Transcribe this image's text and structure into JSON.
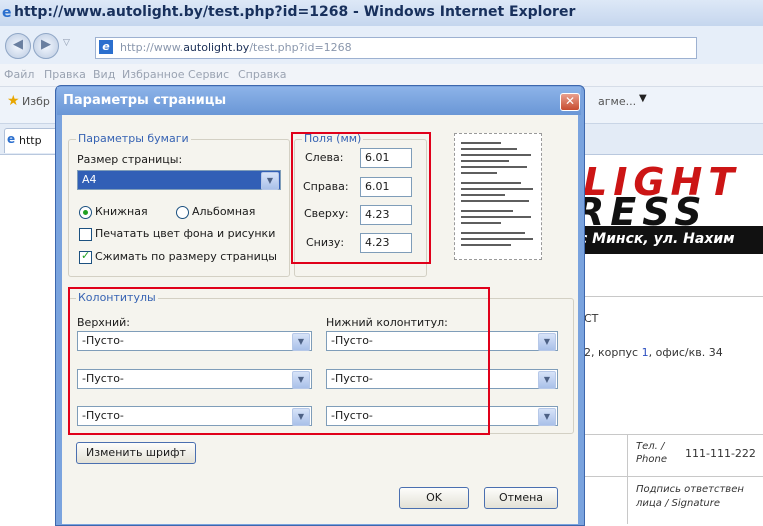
{
  "window": {
    "title": "http://www.autolight.by/test.php?id=1268 - Windows Internet Explorer",
    "address_prefix": "http://www.",
    "address_domain": "autolight.by",
    "address_path": "/test.php?id=1268",
    "menu": [
      "Файл",
      "Правка",
      "Вид",
      "Избранное",
      "Сервис",
      "Справка"
    ],
    "fav_label": "Избр",
    "tab_label": "http",
    "toolbar_suffix": "агме..."
  },
  "background_page": {
    "logo_line1": "LIGHT",
    "logo_line2": "RESS",
    "address_band": "с Минск, ул. Нахим",
    "text1": "СТ",
    "text2_pre": "2, корпус ",
    "text2_num": "1",
    "text2_post": ", офис/кв. 34",
    "phone_label1": "Тел. /",
    "phone_label2": "Phone",
    "phone_value": "111-111-222",
    "sign_label1": "Подпись ответствен",
    "sign_label2": "лица / Signature"
  },
  "dialog": {
    "title": "Параметры страницы",
    "paper": {
      "group_label": "Параметры бумаги",
      "size_label": "Размер страницы:",
      "size_value": "A4",
      "portrait_label": "Книжная",
      "landscape_label": "Альбомная",
      "print_bg_label": "Печатать цвет фона и рисунки",
      "shrink_label": "Сжимать по размеру страницы",
      "portrait_selected": true,
      "print_bg_checked": false,
      "shrink_checked": true
    },
    "margins": {
      "group_label": "Поля (мм)",
      "left_label": "Слева:",
      "left_value": "6.01",
      "right_label": "Справа:",
      "right_value": "6.01",
      "top_label": "Сверху:",
      "top_value": "4.23",
      "bottom_label": "Снизу:",
      "bottom_value": "4.23"
    },
    "headers": {
      "group_label": "Колонтитулы",
      "header_label": "Верхний:",
      "footer_label": "Нижний колонтитул:",
      "header_values": [
        "-Пусто-",
        "-Пусто-",
        "-Пусто-"
      ],
      "footer_values": [
        "-Пусто-",
        "-Пусто-",
        "-Пусто-"
      ]
    },
    "font_button": "Изменить шрифт",
    "ok_button": "OK",
    "cancel_button": "Отмена"
  },
  "colors": {
    "highlight_box": "#e0001a",
    "dialog_frame": "#7aa3de",
    "logo_red": "#cc1515"
  }
}
